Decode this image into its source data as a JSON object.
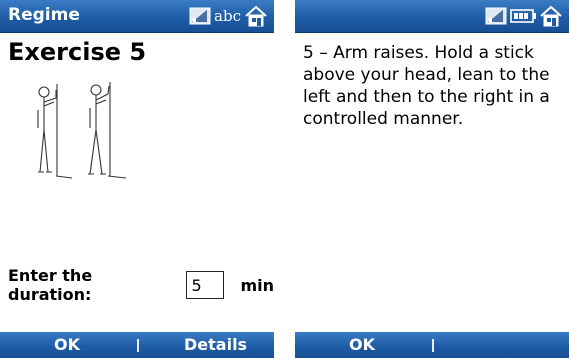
{
  "left_screen": {
    "title": "Regime",
    "input_mode": "abc",
    "exercise_title": "Exercise 5",
    "duration_label": "Enter the duration:",
    "duration_value": "5",
    "unit": "min",
    "softkey_left": "OK",
    "softkey_right": "Details"
  },
  "right_screen": {
    "title": "",
    "description": "5 – Arm raises. Hold a stick above your head, lean to the left and then to the right in a controlled manner.",
    "softkey_left": "OK",
    "softkey_right": ""
  },
  "colors": {
    "titlebar": "#1f5da7",
    "softbar": "#1f5da7",
    "text_on_bar": "#ffffff"
  },
  "icons": {
    "signal": "signal-icon",
    "home": "home-icon",
    "battery": "battery-icon"
  }
}
